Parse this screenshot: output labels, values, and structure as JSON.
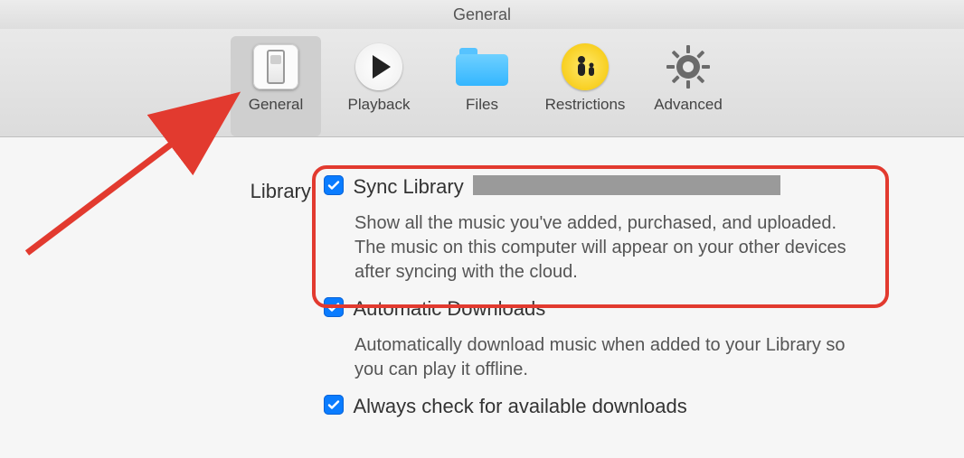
{
  "window": {
    "title": "General"
  },
  "tabs": [
    {
      "id": "general",
      "label": "General",
      "selected": true
    },
    {
      "id": "playback",
      "label": "Playback",
      "selected": false
    },
    {
      "id": "files",
      "label": "Files",
      "selected": false
    },
    {
      "id": "restrictions",
      "label": "Restrictions",
      "selected": false
    },
    {
      "id": "advanced",
      "label": "Advanced",
      "selected": false
    }
  ],
  "library": {
    "section_label": "Library:",
    "options": [
      {
        "id": "sync_library",
        "checked": true,
        "title": "Sync Library",
        "redacted_after_title": true,
        "description": "Show all the music you've added, purchased, and uploaded. The music on this computer will appear on your other devices after syncing with the cloud."
      },
      {
        "id": "automatic_downloads",
        "checked": true,
        "title": "Automatic Downloads",
        "description": "Automatically download music when added to your Library so you can play it offline."
      },
      {
        "id": "always_check_downloads",
        "checked": true,
        "title": "Always check for available downloads",
        "description": ""
      }
    ]
  },
  "annotations": {
    "arrow_target": "tab-general",
    "highlight_target": "option-sync_library"
  }
}
